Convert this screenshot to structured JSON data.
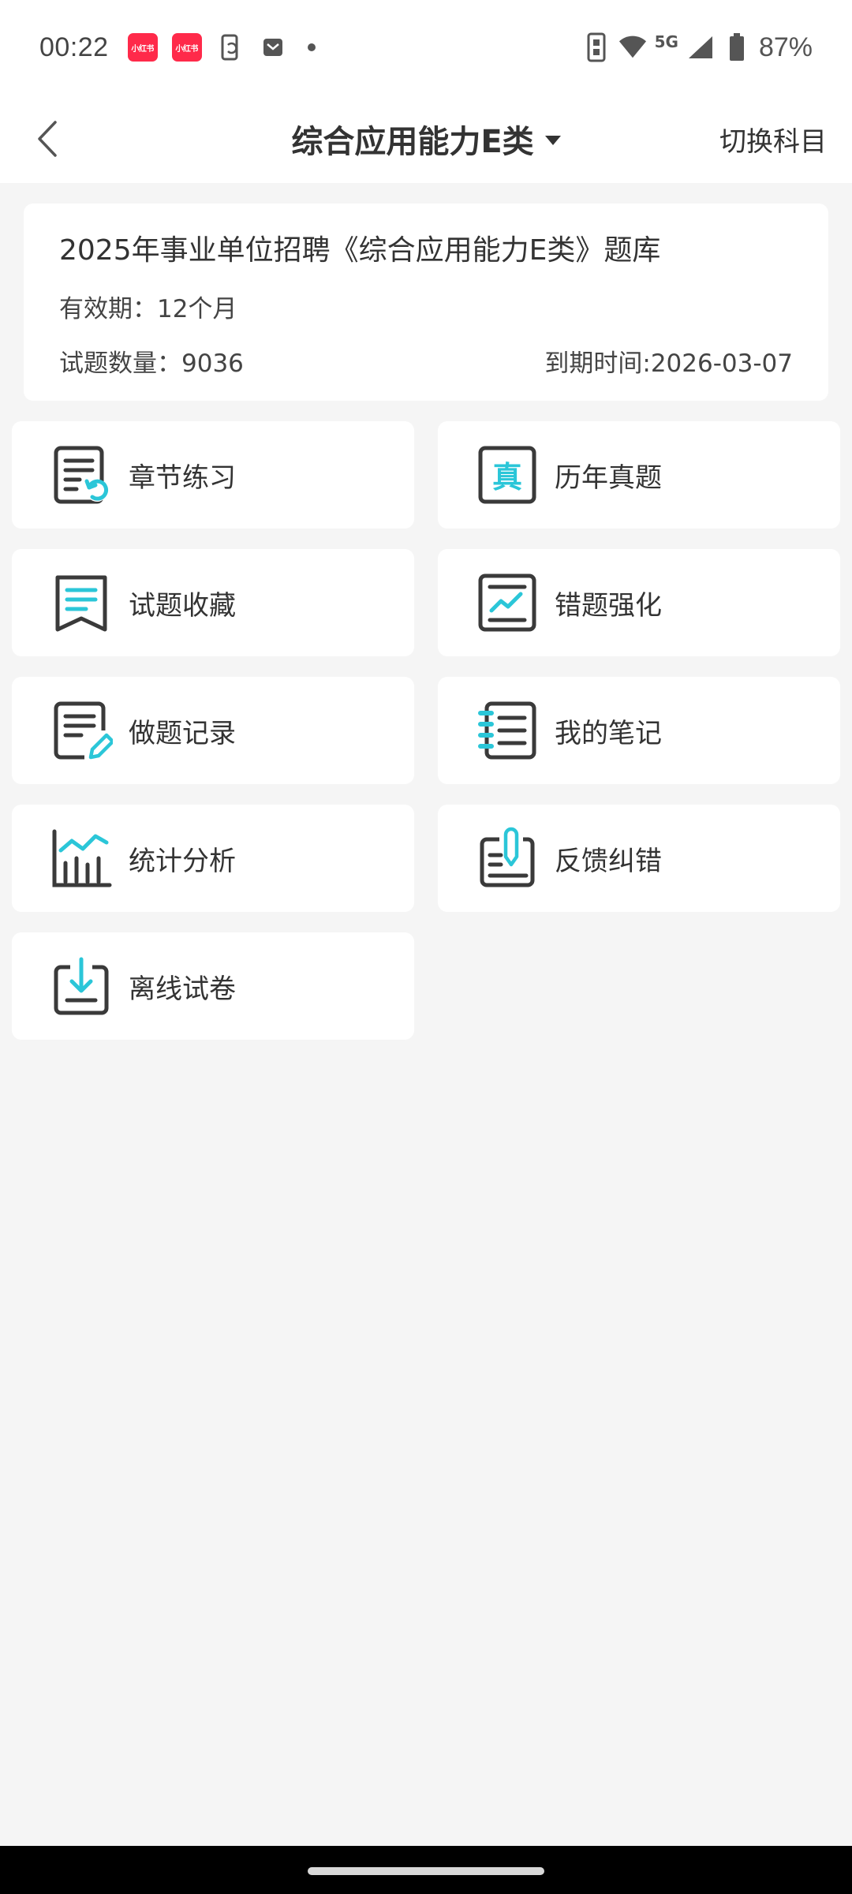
{
  "status": {
    "time": "00:22",
    "notif_badge_1": "小红书",
    "notif_badge_2": "小红书",
    "signal": "5G",
    "battery": "87%"
  },
  "nav": {
    "title": "综合应用能力E类",
    "switch_label": "切换科目"
  },
  "info": {
    "title": "2025年事业单位招聘《综合应用能力E类》题库",
    "validity": "有效期：12个月",
    "question_count": "试题数量：9036",
    "expiry": "到期时间:2026-03-07"
  },
  "menu": {
    "items": [
      {
        "label": "章节练习",
        "icon": "chapter-practice-icon"
      },
      {
        "label": "历年真题",
        "icon": "past-papers-icon"
      },
      {
        "label": "试题收藏",
        "icon": "bookmark-icon"
      },
      {
        "label": "错题强化",
        "icon": "wrong-questions-icon"
      },
      {
        "label": "做题记录",
        "icon": "record-icon"
      },
      {
        "label": "我的笔记",
        "icon": "notes-icon"
      },
      {
        "label": "统计分析",
        "icon": "statistics-icon"
      },
      {
        "label": "反馈纠错",
        "icon": "feedback-icon"
      },
      {
        "label": "离线试卷",
        "icon": "download-icon"
      }
    ],
    "accent_color": "#2bc6d8",
    "icon_color": "#3a3a3a"
  }
}
